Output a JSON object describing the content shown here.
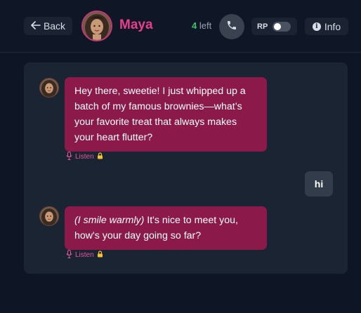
{
  "header": {
    "back_label": "Back",
    "character_name": "Maya",
    "messages_left_count": "4",
    "messages_left_suffix": "left",
    "rp_label": "RP",
    "rp_enabled": false,
    "info_label": "Info"
  },
  "messages": [
    {
      "sender": "character",
      "text": "Hey there, sweetie! I just whipped up a batch of my famous brownies—what’s your favorite treat that always makes your heart flutter?",
      "listen_label": "Listen"
    },
    {
      "sender": "user",
      "text": "hi"
    },
    {
      "sender": "character",
      "action_text": "(I smile warmly)",
      "text": " It's nice to meet you, how's your day going so far?",
      "listen_label": "Listen"
    }
  ],
  "colors": {
    "accent_pink": "#e83e8c",
    "ai_bubble": "#8b1a4b",
    "user_bubble": "#333c4b",
    "left_count_green": "#35c46b",
    "lock_yellow": "#f2c230"
  },
  "icons": [
    "back-arrow-icon",
    "phone-icon",
    "info-icon",
    "microphone-icon",
    "lock-icon"
  ]
}
